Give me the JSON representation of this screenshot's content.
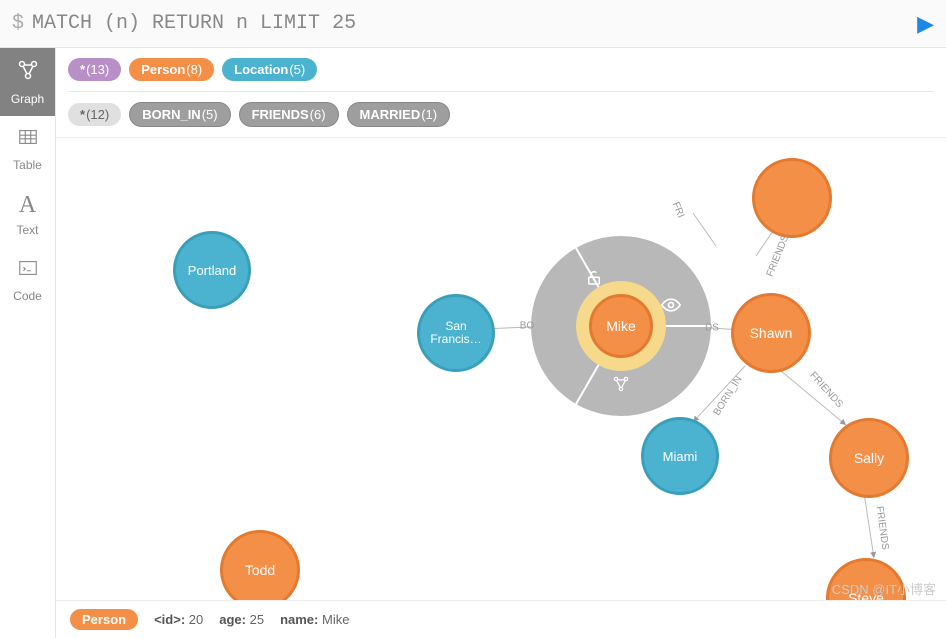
{
  "query": {
    "prompt": "$",
    "text": "MATCH (n) RETURN n LIMIT 25"
  },
  "sidebar": {
    "items": [
      {
        "label": "Graph",
        "icon": "graph"
      },
      {
        "label": "Table",
        "icon": "table"
      },
      {
        "label": "Text",
        "icon": "text"
      },
      {
        "label": "Code",
        "icon": "code"
      }
    ]
  },
  "node_labels": {
    "all": {
      "prefix": "*",
      "count": "(13)"
    },
    "person": {
      "name": "Person",
      "count": "(8)"
    },
    "location": {
      "name": "Location",
      "count": "(5)"
    }
  },
  "rel_labels": {
    "all": {
      "prefix": "*",
      "count": "(12)"
    },
    "born_in": {
      "name": "BORN_IN",
      "count": "(5)"
    },
    "friends": {
      "name": "FRIENDS",
      "count": "(6)"
    },
    "married": {
      "name": "MARRIED",
      "count": "(1)"
    }
  },
  "nodes": {
    "portland": "Portland",
    "sanfran": "San Francis…",
    "mike": "Mike",
    "shawn": "Shawn",
    "miami": "Miami",
    "sally": "Sally",
    "todd": "Todd",
    "steve": "Steve"
  },
  "edges": {
    "friends1": "FRIENDS",
    "friends2": "FRIENDS",
    "friends3": "FRIENDS",
    "friends4": "FRIENDS",
    "friends5": "FRIENDS",
    "born_in1": "BORN_IN",
    "bo": "BO",
    "os": "DS",
    "fri": "FRI"
  },
  "bottom": {
    "label": "Person",
    "id_key": "<id>:",
    "id_val": "20",
    "age_key": "age:",
    "age_val": "25",
    "name_key": "name:",
    "name_val": "Mike"
  },
  "watermark": "CSDN @IT小博客"
}
